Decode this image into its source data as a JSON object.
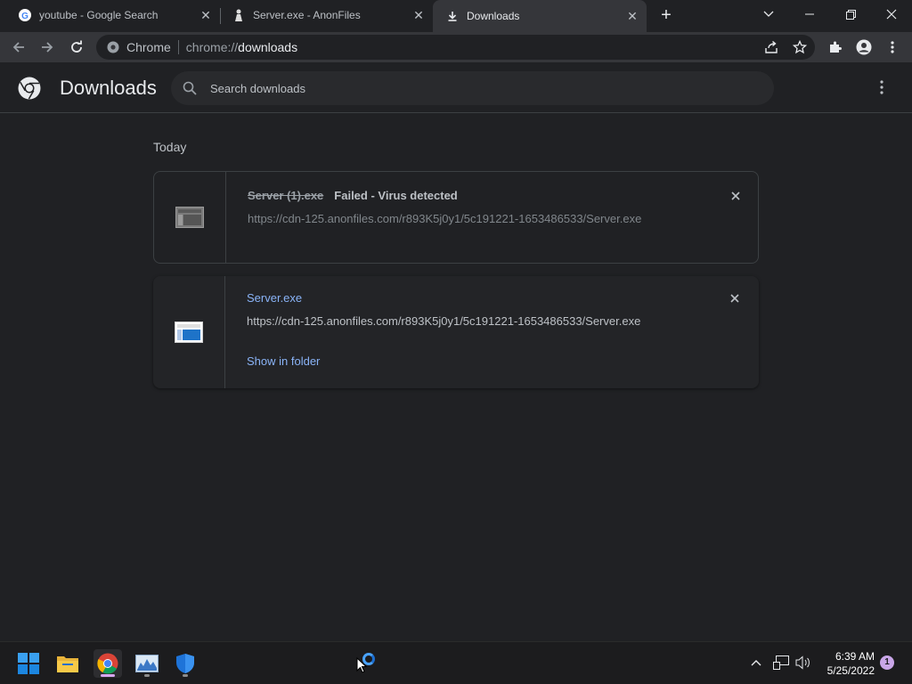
{
  "tabs": [
    {
      "title": "youtube - Google Search",
      "favicon": "google-g-icon"
    },
    {
      "title": "Server.exe - AnonFiles",
      "favicon": "anonfiles-icon"
    },
    {
      "title": "Downloads",
      "favicon": "download-icon",
      "active": true
    }
  ],
  "omnibox": {
    "site_label": "Chrome",
    "url_prefix": "chrome://",
    "url_path": "downloads"
  },
  "page": {
    "title": "Downloads",
    "search_placeholder": "Search downloads"
  },
  "section": {
    "label": "Today"
  },
  "downloads": [
    {
      "filename": "Server (1).exe",
      "status": "Failed - Virus detected",
      "url": "https://cdn-125.anonfiles.com/r893K5j0y1/5c191221-1653486533/Server.exe"
    },
    {
      "filename": "Server.exe",
      "url": "https://cdn-125.anonfiles.com/r893K5j0y1/5c191221-1653486533/Server.exe",
      "action": "Show in folder"
    }
  ],
  "taskbar": {
    "time": "6:39 AM",
    "date": "5/25/2022",
    "notification_count": "1"
  },
  "colors": {
    "accent_link": "#8ab4f8",
    "background": "#202124",
    "toolbar": "#35363a"
  }
}
